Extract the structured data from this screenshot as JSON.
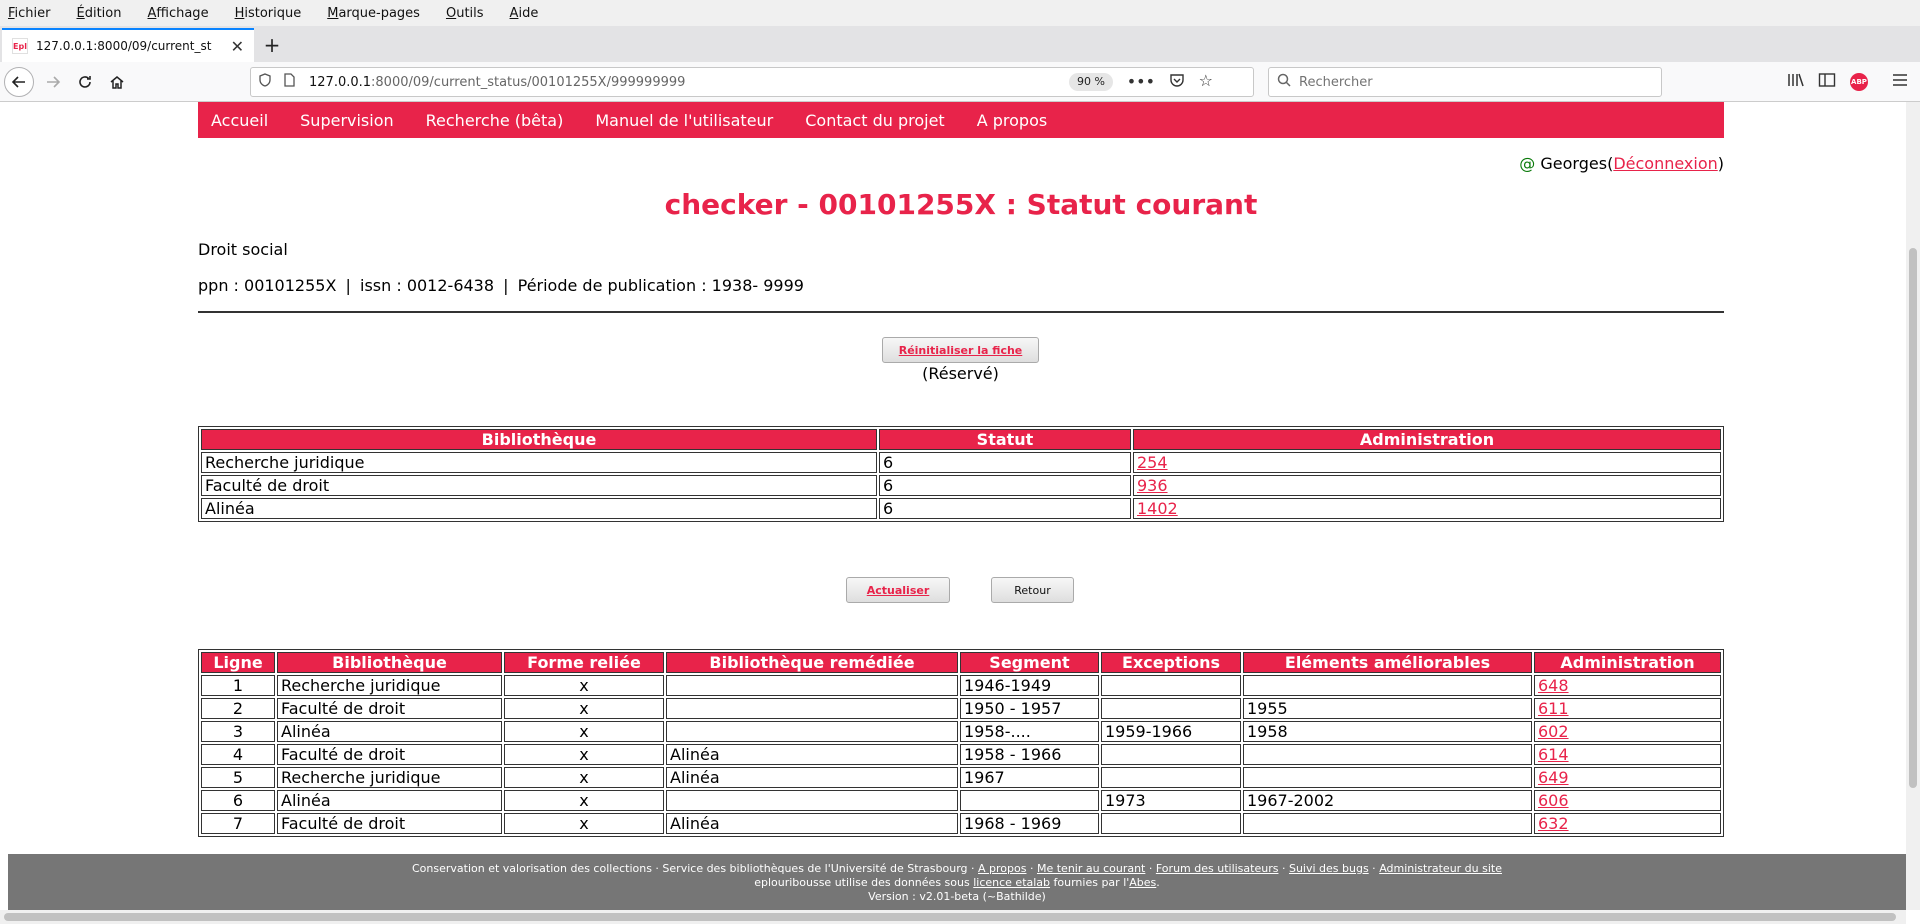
{
  "browser": {
    "menu": [
      "Fichier",
      "Édition",
      "Affichage",
      "Historique",
      "Marque-pages",
      "Outils",
      "Aide"
    ],
    "tab": {
      "favicon": "Epl",
      "title": "127.0.0.1:8000/09/current_st"
    },
    "url": {
      "host": "127.0.0.1",
      "path": ":8000/09/current_status/00101255X/999999999"
    },
    "zoom": "90 %",
    "search_placeholder": "Rechercher",
    "abp": "ABP"
  },
  "site_nav": [
    "Accueil",
    "Supervision",
    "Recherche (bêta)",
    "Manuel de l'utilisateur",
    "Contact du projet",
    "A propos"
  ],
  "user": {
    "at": "@",
    "name": "Georges",
    "open": "(",
    "logout": "Déconnexion",
    "close": ")"
  },
  "title": "checker - 00101255X : Statut courant",
  "subtitle": "Droit social",
  "meta": {
    "ppn": "ppn : 00101255X",
    "issn": "issn : 0012-6438",
    "period": "Période de publication : 1938- 9999",
    "sep": "|"
  },
  "buttons": {
    "reset": "Réinitialiser la fiche",
    "reserved": "(Réservé)",
    "refresh": "Actualiser",
    "back": "Retour"
  },
  "status_table": {
    "headers": [
      "Bibliothèque",
      "Statut",
      "Administration"
    ],
    "rows": [
      [
        "Recherche juridique",
        "6",
        "254"
      ],
      [
        "Faculté de droit",
        "6",
        "936"
      ],
      [
        "Alinéa",
        "6",
        "1402"
      ]
    ]
  },
  "lines_table": {
    "headers": [
      "Ligne",
      "Bibliothèque",
      "Forme reliée",
      "Bibliothèque remédiée",
      "Segment",
      "Exceptions",
      "Eléments améliorables",
      "Administration"
    ],
    "rows": [
      [
        "1",
        "Recherche juridique",
        "x",
        "",
        "1946-1949",
        "",
        "",
        "648"
      ],
      [
        "2",
        "Faculté de droit",
        "x",
        "",
        "1950 - 1957",
        "",
        "1955",
        "611"
      ],
      [
        "3",
        "Alinéa",
        "x",
        "",
        "1958-....",
        "1959-1966",
        "1958",
        "602"
      ],
      [
        "4",
        "Faculté de droit",
        "x",
        "Alinéa",
        "1958 - 1966",
        "",
        "",
        "614"
      ],
      [
        "5",
        "Recherche juridique",
        "x",
        "Alinéa",
        "1967",
        "",
        "",
        "649"
      ],
      [
        "6",
        "Alinéa",
        "x",
        "",
        "",
        "1973",
        "1967-2002",
        "606"
      ],
      [
        "7",
        "Faculté de droit",
        "x",
        "Alinéa",
        "1968 - 1969",
        "",
        "",
        "632"
      ]
    ]
  },
  "footer": {
    "line1_text": "Conservation et valorisation des collections · Service des bibliothèques de l'Université de Strasbourg · ",
    "links1": [
      "A propos",
      "Me tenir au courant",
      "Forum des utilisateurs",
      "Suivi des bugs",
      "Administrateur du site"
    ],
    "dot": " · ",
    "line2_a": "eplouribousse utilise des données sous ",
    "line2_link1": "licence etalab",
    "line2_b": " fournies par l'",
    "line2_link2": "Abes",
    "line2_c": ".",
    "line3": "Version : v2.01-beta (~Bathilde)"
  }
}
